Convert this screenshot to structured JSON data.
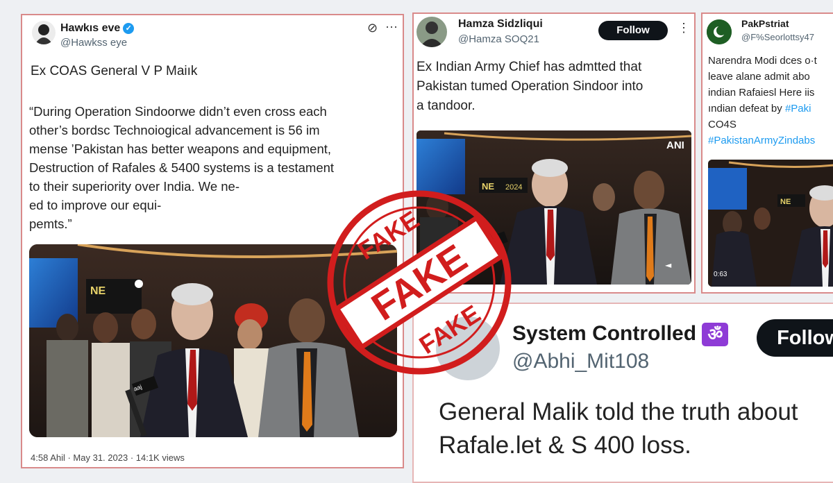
{
  "tweet1": {
    "display_name": "Hawkıs eve",
    "handle": "@Hawkss eye",
    "heading": "Ex COAS General V P Maiık",
    "quote": "“During Operation Sindoorwe didn’t even cross each\nother’s bordsc Technoiogical advancement is 56 im\nmense ’Pakistan has better weapons and equipment,\nDestruction of Rafales & 5400 systems is a testament\nto their superiority over India. We ne-\ned to improve our equi-\npemts.”",
    "timestamp": "4:58 Ahil · May 31. 2023 · 14:1K views",
    "video_sign": "NE"
  },
  "tweet2": {
    "display_name": "Hamza Sidzliqui",
    "handle": "@Hamza SOQ21",
    "follow_label": "Follow",
    "text": "Ex Indian Army Chief has admtted that\nPakistan tumed Operation Sindoor into\na tandoor.",
    "watermark": "ANI",
    "video_sign": "NE",
    "video_year": "2024"
  },
  "tweet3": {
    "display_name": "PakPstriat",
    "handle": "@F%Seorlottsy47",
    "text_line1": "Narendra Modi dces ο·t",
    "text_line2": "leave alane admit abo",
    "text_line3": "indian Rafaiesl Here iis",
    "text_line4_prefix": "ındian defeat by",
    "text_line4_tag": "#Paki",
    "text_line5": "CO4S",
    "hashtag2": "#PakistanArmyZindabs",
    "video_sign": "NE",
    "video_time": "0:63"
  },
  "tweet4": {
    "display_name": "System Controlled",
    "om_symbol": "ॐ",
    "handle": "@Abhi_Mit108",
    "follow_label": "Follow",
    "text_line1": "General Malik told the truth about",
    "text_line2": "Rafale.let & S 400 loss."
  },
  "stamp": {
    "label": "FAKE",
    "color": "#d11d1d"
  },
  "mic_label": "aaj"
}
